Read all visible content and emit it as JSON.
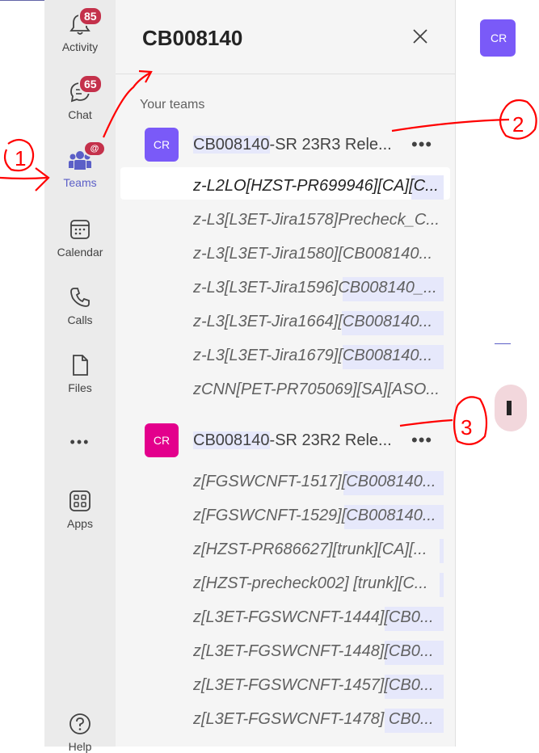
{
  "rail": {
    "activity": {
      "label": "Activity",
      "badge": "85",
      "icon": "bell-icon"
    },
    "chat": {
      "label": "Chat",
      "badge": "65",
      "icon": "chat-icon"
    },
    "teams": {
      "label": "Teams",
      "badge": "@",
      "icon": "teams-icon"
    },
    "calendar": {
      "label": "Calendar",
      "icon": "calendar-icon"
    },
    "calls": {
      "label": "Calls",
      "icon": "phone-icon"
    },
    "files": {
      "label": "Files",
      "icon": "file-icon"
    },
    "more": {
      "label": "•••",
      "icon": "more-icon"
    },
    "apps": {
      "label": "Apps",
      "icon": "apps-icon"
    },
    "help": {
      "label": "Help",
      "icon": "help-icon"
    }
  },
  "panel": {
    "title": "CB008140",
    "section_label": "Your teams",
    "teams": [
      {
        "avatar": "CR",
        "avatar_color": "#7a5af8",
        "name_highlight": "CB008140",
        "name_rest": "-SR 23R3 Rele...",
        "more": "•••",
        "channels": [
          {
            "text": "z-L2LO[HZST-PR699946][CA][C..."
          },
          {
            "text": "z-L3[L3ET-Jira1578]Precheck_C..."
          },
          {
            "text": "z-L3[L3ET-Jira1580][CB008140..."
          },
          {
            "text": "z-L3[L3ET-Jira1596]CB008140_..."
          },
          {
            "text": "z-L3[L3ET-Jira1664][CB008140..."
          },
          {
            "text": "z-L3[L3ET-Jira1679][CB008140..."
          },
          {
            "text": "zCNN[PET-PR705069][SA][ASO..."
          }
        ]
      },
      {
        "avatar": "CR",
        "avatar_color": "#e3008c",
        "name_highlight": "CB008140",
        "name_rest": "-SR 23R2 Rele...",
        "more": "•••",
        "channels": [
          {
            "text": "z[FGSWCNFT-1517][CB008140..."
          },
          {
            "text": "z[FGSWCNFT-1529][CB008140..."
          },
          {
            "text": "z[HZST-PR686627][trunk][CA][..."
          },
          {
            "text": "z[HZST-precheck002] [trunk][C..."
          },
          {
            "text": "z[L3ET-FGSWCNFT-1444][CB0..."
          },
          {
            "text": "z[L3ET-FGSWCNFT-1448][CB0..."
          },
          {
            "text": "z[L3ET-FGSWCNFT-1457][CB0..."
          },
          {
            "text": "z[L3ET-FGSWCNFT-1478] CB0..."
          }
        ]
      }
    ]
  },
  "main": {
    "avatar": "CR",
    "avatar_color": "#7a5af8"
  },
  "annotations": {
    "one": "1",
    "two": "2",
    "three": "3"
  },
  "colors": {
    "accent": "#5b5fc7",
    "badge": "#c4314b",
    "ink": "#ff0000"
  }
}
